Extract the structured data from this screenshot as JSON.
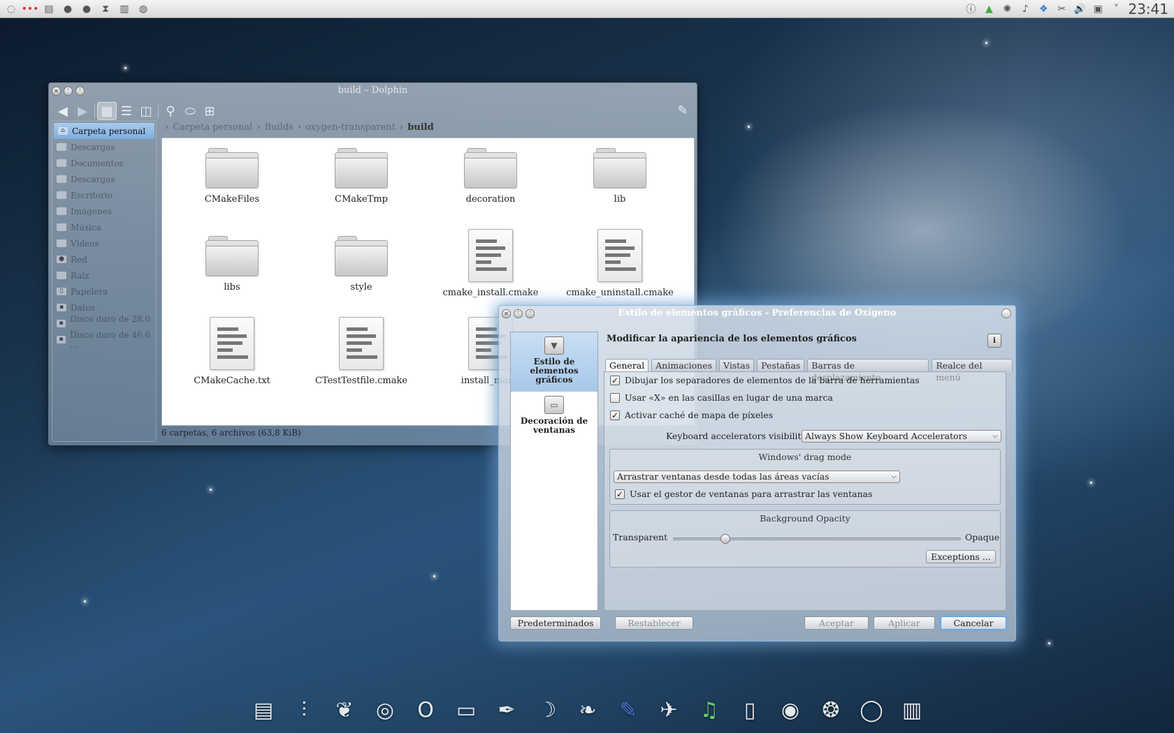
{
  "top_panel": {
    "left_icons": [
      "kde-menu-icon",
      "dots-icon",
      "window-list-icon",
      "app1-icon",
      "app2-icon",
      "app3-icon",
      "app4-icon",
      "app5-icon"
    ],
    "tray_icons": [
      "info-icon",
      "package-icon",
      "cloud-icon",
      "music-icon",
      "dropbox-icon",
      "klipper-icon",
      "volume-icon",
      "network-icon",
      "expand-icon"
    ],
    "clock": "23:41"
  },
  "dolphin": {
    "title": "build – Dolphin",
    "toolbar": [
      "back-icon",
      "forward-icon",
      "icons-view-icon",
      "details-view-icon",
      "split-view-icon",
      "search-icon",
      "preview-icon",
      "panels-icon"
    ],
    "places": [
      {
        "label": "Carpeta personal",
        "selected": true
      },
      {
        "label": "Descargas"
      },
      {
        "label": "Documentos"
      },
      {
        "label": "Descargas"
      },
      {
        "label": "Escritorio"
      },
      {
        "label": "Imágenes"
      },
      {
        "label": "Música"
      },
      {
        "label": "Vídeos"
      },
      {
        "label": "Red"
      },
      {
        "label": "Raíz"
      },
      {
        "label": "Papelera"
      },
      {
        "label": "Datos"
      },
      {
        "label": "Disco duro de 28,0 ..."
      },
      {
        "label": "Disco duro de 46,6 ..."
      }
    ],
    "breadcrumb": [
      "Carpeta personal",
      "Builds",
      "oxygen-transparent",
      "build"
    ],
    "files": [
      {
        "name": "CMakeFiles",
        "type": "folder"
      },
      {
        "name": "CMakeTmp",
        "type": "folder"
      },
      {
        "name": "decoration",
        "type": "folder"
      },
      {
        "name": "lib",
        "type": "folder"
      },
      {
        "name": "libs",
        "type": "folder"
      },
      {
        "name": "style",
        "type": "folder"
      },
      {
        "name": "cmake_install.cmake",
        "type": "doc"
      },
      {
        "name": "cmake_uninstall.cmake",
        "type": "doc"
      },
      {
        "name": "CMakeCache.txt",
        "type": "doc"
      },
      {
        "name": "CTestTestfile.cmake",
        "type": "doc"
      },
      {
        "name": "install_manif",
        "type": "doc"
      }
    ],
    "status": "6 carpetas, 6 archivos (63,8 KiB)"
  },
  "oxygen": {
    "title": "Estilo de elementos gráficos - Preferencias de Oxígeno",
    "sidebar": [
      {
        "label": "Estilo de elementos gráficos",
        "selected": true
      },
      {
        "label": "Decoración de ventanas"
      }
    ],
    "heading": "Modificar la apariencia de los elementos gráficos",
    "tabs": [
      "General",
      "Animaciones",
      "Vistas",
      "Pestañas",
      "Barras de desplazamiento",
      "Realce del menú"
    ],
    "general": {
      "chk_separators": "Dibujar los separadores de elementos de la barra de herramientas",
      "chk_x": "Usar «X» en las casillas en lugar de una marca",
      "chk_cache": "Activar caché de mapa de píxeles",
      "accel_label": "Keyboard accelerators visibility:",
      "accel_value": "Always Show Keyboard Accelerators",
      "drag_title": "Windows' drag mode",
      "drag_value": "Arrastrar ventanas desde todas las áreas vacías",
      "chk_wm": "Usar el gestor de ventanas para arrastrar las ventanas",
      "opacity_title": "Background Opacity",
      "opacity_min": "Transparent",
      "opacity_max": "Opaque",
      "opacity_value": 0.17,
      "exceptions": "Exceptions ..."
    },
    "buttons": {
      "defaults": "Predeterminados",
      "reset": "Restablecer",
      "ok": "Aceptar",
      "apply": "Aplicar",
      "cancel": "Cancelar"
    }
  },
  "dock": [
    "dolphin-icon",
    "mixer-icon",
    "gimp-icon",
    "chrome-icon",
    "opera-icon",
    "terminal-icon",
    "inkscape-icon",
    "kde-icon",
    "bird-icon",
    "editor-icon",
    "twitter-icon",
    "audio-icon",
    "trash-icon",
    "chromium-icon",
    "firefox-icon",
    "opera-next-icon",
    "files-icon"
  ]
}
